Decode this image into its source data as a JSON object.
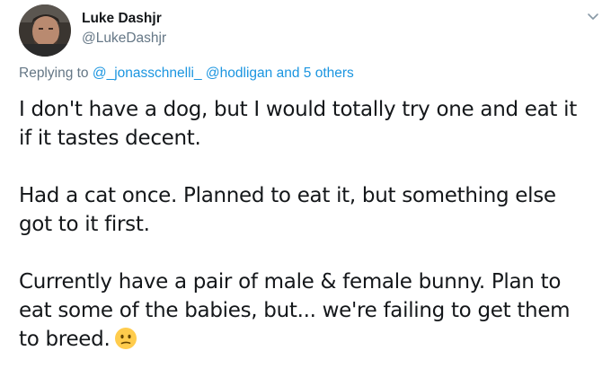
{
  "author": {
    "display_name": "Luke Dashjr",
    "handle": "@LukeDashjr",
    "avatar_icon": "profile-photo"
  },
  "reply": {
    "prefix": "Replying to",
    "mention_1": "@_jonasschnelli_",
    "mention_2": "@hodligan",
    "connector": "and",
    "others": "5 others"
  },
  "tweet": {
    "paragraph_1": "I don't have a dog, but I would totally try one and eat it if it tastes decent.",
    "paragraph_2": "Had a cat once. Planned to eat it, but something else got to it first.",
    "paragraph_3": "Currently have a pair of male & female bunny. Plan to eat some of the babies, but... we're failing to get them to breed.",
    "emoji": "confused-face"
  },
  "colors": {
    "link": "#1b95e0",
    "secondary_text": "#657786",
    "primary_text": "#14171a"
  }
}
